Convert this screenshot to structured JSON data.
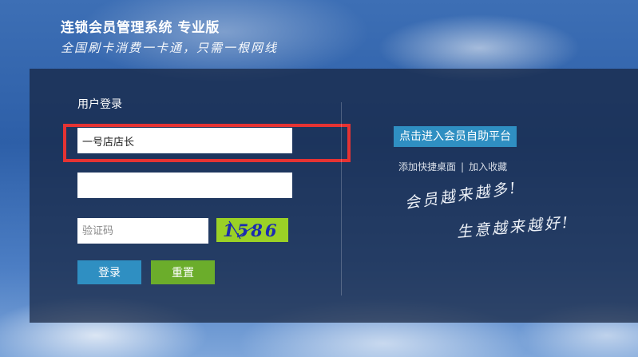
{
  "header": {
    "title": "连锁会员管理系统 专业版",
    "slogan": "全国刷卡消费一卡通，只需一根网线"
  },
  "login": {
    "heading": "用户登录",
    "username_value": "一号店店长",
    "password_value": "",
    "captcha_placeholder": "验证码",
    "captcha_text": "1586",
    "login_label": "登录",
    "reset_label": "重置"
  },
  "side": {
    "portal_label": "点击进入会员自助平台",
    "shortcut_label": "添加快捷桌面",
    "separator": "|",
    "favorite_label": "加入收藏",
    "motto_line1": "会员越来越多!",
    "motto_line2": "生意越来越好!"
  },
  "colors": {
    "highlight": "#e53333",
    "login_button": "#2f8fc2",
    "reset_button": "#6bad2b",
    "captcha_bg": "#9bd126",
    "captcha_text": "#1c2bb0"
  }
}
